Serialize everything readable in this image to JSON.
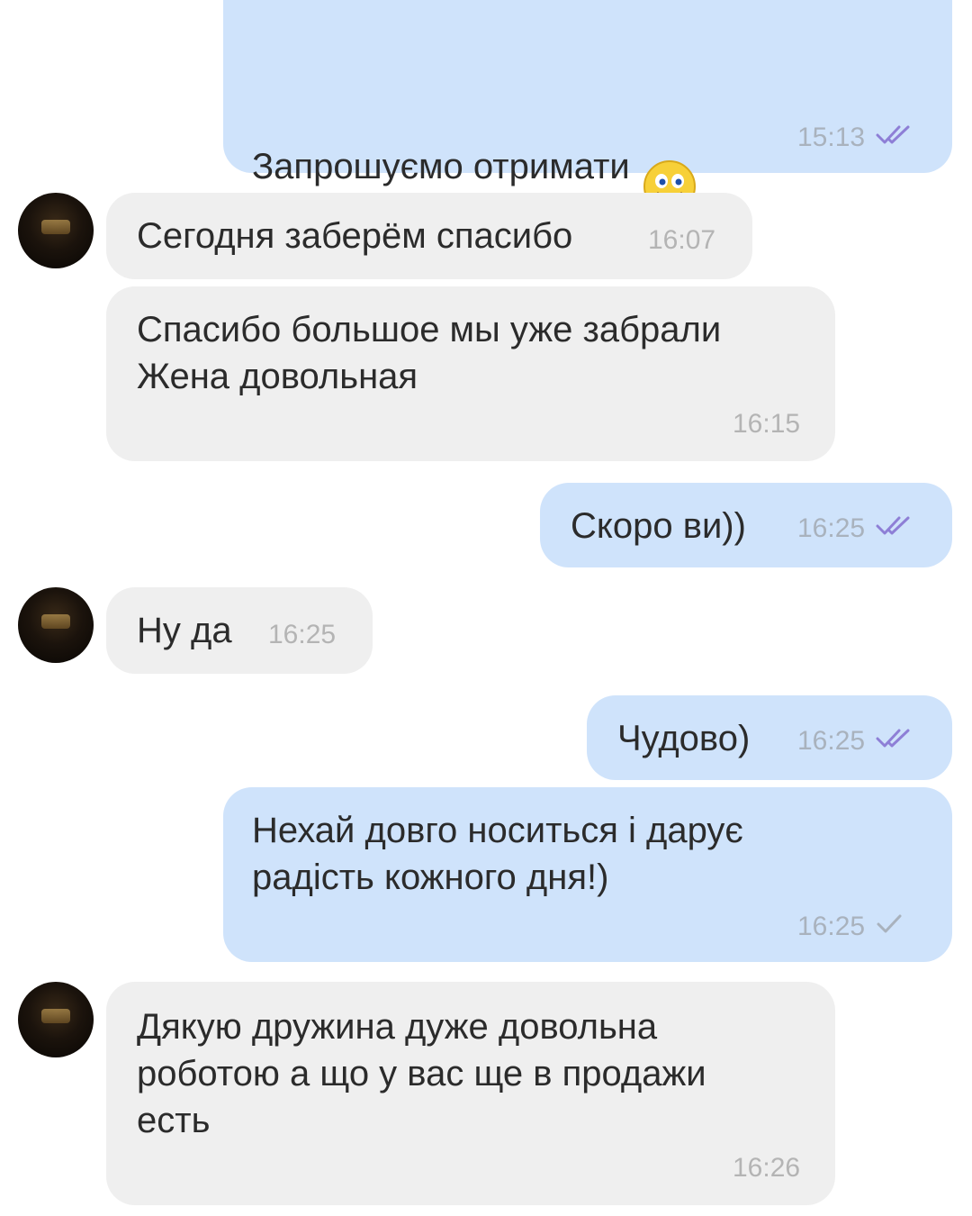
{
  "messages": [
    {
      "side": "out",
      "text": "Запрошуємо отримати",
      "time": "15:13",
      "status": "read",
      "emoji": "smiley-emoji"
    },
    {
      "side": "in",
      "text": "Сегодня заберём спасибо",
      "time": "16:07"
    },
    {
      "side": "in",
      "text": "Спасибо большое мы уже забрали\nЖена довольная",
      "time": "16:15"
    },
    {
      "side": "out",
      "text": "Скоро ви))",
      "time": "16:25",
      "status": "read"
    },
    {
      "side": "in",
      "text": "Ну да",
      "time": "16:25"
    },
    {
      "side": "out",
      "text": "Чудово)",
      "time": "16:25",
      "status": "read"
    },
    {
      "side": "out",
      "text": "Нехай довго носиться і дарує\nрадість кожного дня!)",
      "time": "16:25",
      "status": "sent"
    },
    {
      "side": "in",
      "text": "Дякую дружина дуже довольна\nроботою а що у вас ще в продажи\nесть",
      "time": "16:26"
    }
  ],
  "colors": {
    "outgoing_bubble": "#cfe3fb",
    "incoming_bubble": "#efefef",
    "read_ticks": "#8e7fd6",
    "sent_tick": "#a9b2bd"
  },
  "icons": [
    "double-check-icon",
    "single-check-icon",
    "smiley-emoji",
    "avatar"
  ]
}
